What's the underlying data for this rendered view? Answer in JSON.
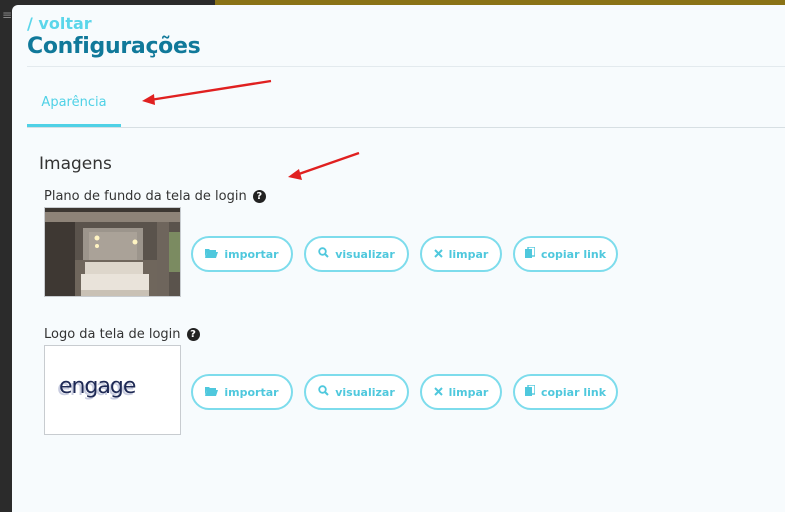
{
  "header": {
    "back_label": "/ voltar",
    "title": "Configurações"
  },
  "tabs": [
    {
      "label": "Aparência",
      "active": true
    }
  ],
  "section": {
    "title": "Imagens"
  },
  "fields": [
    {
      "label": "Plano de fundo da tela de login",
      "buttons": {
        "import": "importar",
        "view": "visualizar",
        "clear": "limpar",
        "copy": "copiar link"
      }
    },
    {
      "label": "Logo da tela de login",
      "logo_text": "engage",
      "buttons": {
        "import": "importar",
        "view": "visualizar",
        "clear": "limpar",
        "copy": "copiar link"
      }
    }
  ],
  "colors": {
    "accent": "#4fd1e6",
    "title": "#10799a",
    "annotation_arrow": "#e02020"
  },
  "icons": {
    "help": "question-circle-icon",
    "import": "folder-open-icon",
    "view": "search-icon",
    "clear": "close-icon",
    "copy": "copy-icon"
  }
}
